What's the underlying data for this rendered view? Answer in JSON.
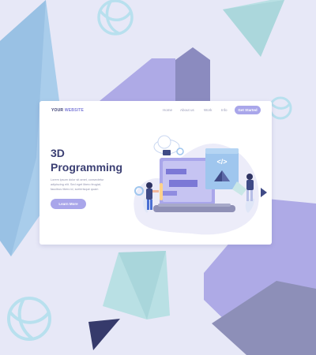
{
  "header": {
    "logo_prefix": "YOUR",
    "logo_accent": "WEBSITE",
    "nav": [
      "Home",
      "About us",
      "Work",
      "Info"
    ],
    "cta": "Get Started"
  },
  "hero": {
    "title_line1": "3D",
    "title_line2": "Programming",
    "description": "Lorem ipsum dolor sit amet, consectetur adipiscing elit. Sed eget libero feugiat, faucibus libero id, scelerisque quam",
    "button": "Learn More"
  },
  "illustration": {
    "code_symbol": "</>"
  },
  "colors": {
    "background": "#e7e8f7",
    "accent": "#a9a6ea",
    "title": "#3b3f73",
    "text": "#8f91ad"
  },
  "icons": [
    "globe-icon",
    "code-icon",
    "cloud-icon",
    "gear-icon",
    "play-icon"
  ]
}
